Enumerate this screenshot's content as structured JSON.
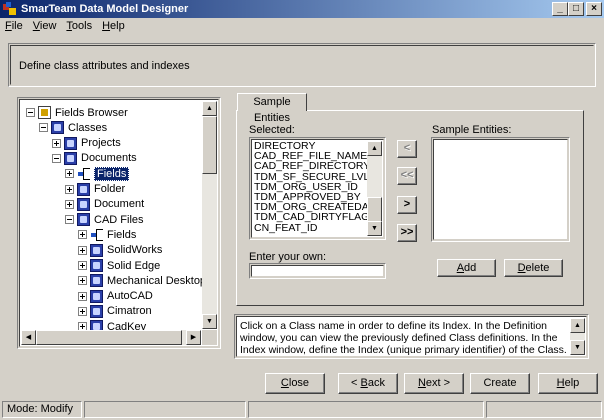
{
  "app": {
    "title": "SmarTeam Data Model Designer"
  },
  "window_controls": {
    "minimize": "_",
    "maximize": "□",
    "close": "×"
  },
  "menu": [
    {
      "label": "File",
      "mnemonic": "F",
      "rest": "ile"
    },
    {
      "label": "View",
      "mnemonic": "V",
      "rest": "iew"
    },
    {
      "label": "Tools",
      "mnemonic": "T",
      "rest": "ools"
    },
    {
      "label": "Help",
      "mnemonic": "H",
      "rest": "elp"
    }
  ],
  "banner": {
    "text": "Define class attributes and indexes"
  },
  "tree": {
    "items": [
      {
        "label": "Fields Browser",
        "level": 0,
        "expander": "minus",
        "icon": "browser-icon"
      },
      {
        "label": "Classes",
        "level": 1,
        "expander": "minus",
        "icon": "class-icon"
      },
      {
        "label": "Projects",
        "level": 2,
        "expander": "plus",
        "icon": "class-icon"
      },
      {
        "label": "Documents",
        "level": 2,
        "expander": "minus",
        "icon": "class-icon"
      },
      {
        "label": "Fields",
        "level": 3,
        "expander": "plus",
        "icon": "fields-icon",
        "selected": true
      },
      {
        "label": "Folder",
        "level": 3,
        "expander": "plus",
        "icon": "class-icon"
      },
      {
        "label": "Document",
        "level": 3,
        "expander": "plus",
        "icon": "class-icon"
      },
      {
        "label": "CAD Files",
        "level": 3,
        "expander": "minus",
        "icon": "class-icon"
      },
      {
        "label": "Fields",
        "level": 4,
        "expander": "plus",
        "icon": "fields-icon"
      },
      {
        "label": "SolidWorks",
        "level": 4,
        "expander": "plus",
        "icon": "class-icon"
      },
      {
        "label": "Solid Edge",
        "level": 4,
        "expander": "plus",
        "icon": "class-icon"
      },
      {
        "label": "Mechanical Desktop",
        "level": 4,
        "expander": "plus",
        "icon": "class-icon"
      },
      {
        "label": "AutoCAD",
        "level": 4,
        "expander": "plus",
        "icon": "class-icon"
      },
      {
        "label": "Cimatron",
        "level": 4,
        "expander": "plus",
        "icon": "class-icon"
      },
      {
        "label": "CadKey",
        "level": 4,
        "expander": "plus",
        "icon": "class-icon"
      }
    ]
  },
  "tab": {
    "label": "Sample Entities"
  },
  "selected_list": {
    "label": "Selected:",
    "items": [
      "DIRECTORY",
      "CAD_REF_FILE_NAME",
      "CAD_REF_DIRECTORY",
      "TDM_SF_SECURE_LVL",
      "TDM_ORG_USER_ID",
      "TDM_APPROVED_BY",
      "TDM_ORG_CREATEDATE",
      "TDM_CAD_DIRTYFLAG",
      "CN_FEAT_ID"
    ]
  },
  "move_buttons": [
    {
      "label": "<",
      "enabled": false,
      "name": "move-left-button"
    },
    {
      "label": "<<",
      "enabled": false,
      "name": "move-all-left-button"
    },
    {
      "label": ">",
      "enabled": true,
      "name": "move-right-button"
    },
    {
      "label": ">>",
      "enabled": true,
      "name": "move-all-right-button"
    }
  ],
  "sample_list": {
    "label": "Sample Entities:",
    "items": []
  },
  "enter_own": {
    "label": "Enter your own:",
    "value": ""
  },
  "add_button": {
    "mnemonic": "A",
    "rest": "dd"
  },
  "delete_button": {
    "mnemonic": "D",
    "rest": "elete"
  },
  "info": {
    "text": "Click on a Class name in order to define its Index. In the Definition window, you can view the previously defined Class definitions. In the Index window, define the Index (unique primary identifier) of the Class."
  },
  "wizard_buttons": [
    {
      "name": "close-button",
      "pre": "",
      "mnemonic": "C",
      "rest": "lose"
    },
    {
      "name": "back-button",
      "pre": "< ",
      "mnemonic": "B",
      "rest": "ack"
    },
    {
      "name": "next-button",
      "pre": "",
      "mnemonic": "N",
      "rest": "ext >"
    },
    {
      "name": "create-button",
      "pre": "",
      "mnemonic": "",
      "rest": "Create"
    },
    {
      "name": "help-button",
      "pre": "",
      "mnemonic": "H",
      "rest": "elp"
    }
  ],
  "status": {
    "mode": "Mode: Modify"
  }
}
